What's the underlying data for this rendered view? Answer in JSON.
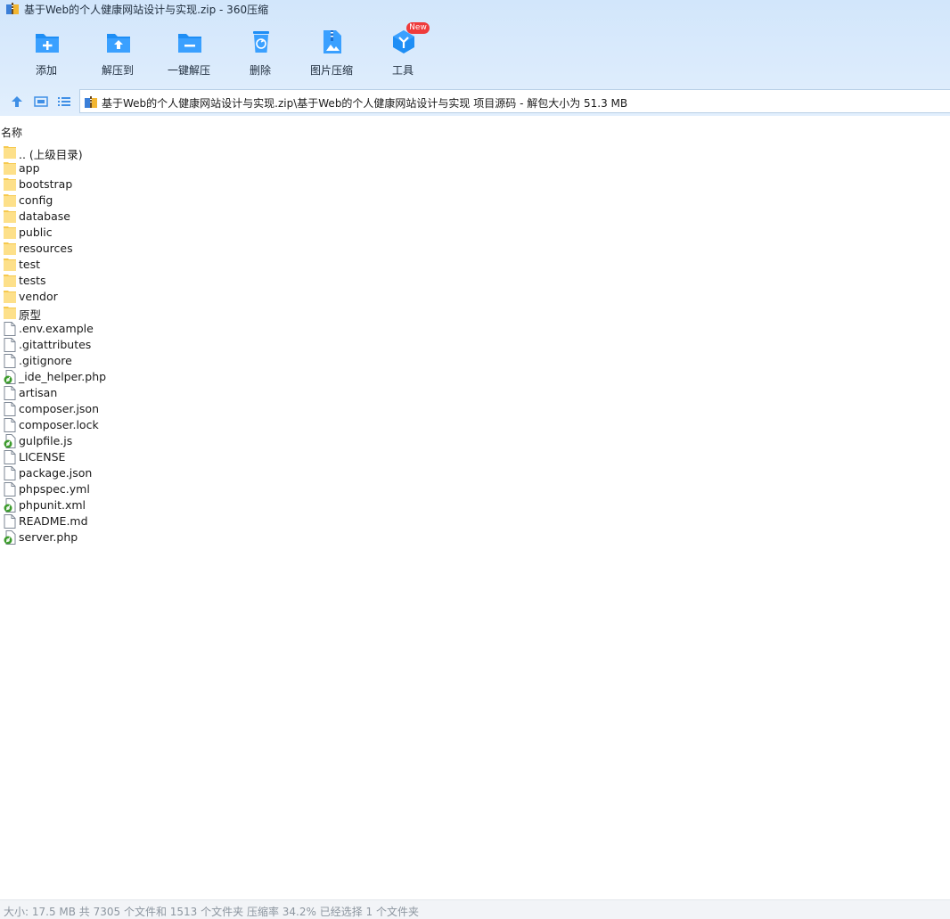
{
  "window": {
    "title": "基于Web的个人健康网站设计与实现.zip - 360压缩",
    "app_icon": "archive-icon"
  },
  "toolbar": {
    "buttons": [
      {
        "label": "添加",
        "icon": "add-icon"
      },
      {
        "label": "解压到",
        "icon": "extract-to-icon"
      },
      {
        "label": "一键解压",
        "icon": "one-click-extract-icon"
      },
      {
        "label": "删除",
        "icon": "delete-icon"
      },
      {
        "label": "图片压缩",
        "icon": "image-compress-icon"
      },
      {
        "label": "工具",
        "icon": "tools-icon",
        "badge": "New"
      }
    ]
  },
  "nav": {
    "up_icon": "arrow-up-icon",
    "view_icon": "thumbnail-view-icon",
    "list_icon": "list-view-icon",
    "address": "基于Web的个人健康网站设计与实现.zip\\基于Web的个人健康网站设计与实现 项目源码 - 解包大小为 51.3 MB"
  },
  "columns": {
    "name": "名称"
  },
  "files": [
    {
      "name": ".. (上级目录)",
      "type": "folder"
    },
    {
      "name": "app",
      "type": "folder"
    },
    {
      "name": "bootstrap",
      "type": "folder"
    },
    {
      "name": "config",
      "type": "folder"
    },
    {
      "name": "database",
      "type": "folder"
    },
    {
      "name": "public",
      "type": "folder"
    },
    {
      "name": "resources",
      "type": "folder"
    },
    {
      "name": "test",
      "type": "folder"
    },
    {
      "name": "tests",
      "type": "folder"
    },
    {
      "name": "vendor",
      "type": "folder"
    },
    {
      "name": "原型",
      "type": "folder"
    },
    {
      "name": ".env.example",
      "type": "file"
    },
    {
      "name": ".gitattributes",
      "type": "file"
    },
    {
      "name": ".gitignore",
      "type": "file"
    },
    {
      "name": "_ide_helper.php",
      "type": "script"
    },
    {
      "name": "artisan",
      "type": "file"
    },
    {
      "name": "composer.json",
      "type": "file"
    },
    {
      "name": "composer.lock",
      "type": "file"
    },
    {
      "name": "gulpfile.js",
      "type": "script"
    },
    {
      "name": "LICENSE",
      "type": "file"
    },
    {
      "name": "package.json",
      "type": "file"
    },
    {
      "name": "phpspec.yml",
      "type": "file"
    },
    {
      "name": "phpunit.xml",
      "type": "script"
    },
    {
      "name": "README.md",
      "type": "file"
    },
    {
      "name": "server.php",
      "type": "script"
    }
  ],
  "status": {
    "text": "大小: 17.5 MB 共 7305 个文件和 1513 个文件夹 压缩率 34.2% 已经选择 1 个文件夹"
  },
  "colors": {
    "accent": "#1e8ef5",
    "toolbar_bg": "#d8e9fc",
    "folder": "#fdd66b",
    "badge": "#ef3b3b"
  }
}
